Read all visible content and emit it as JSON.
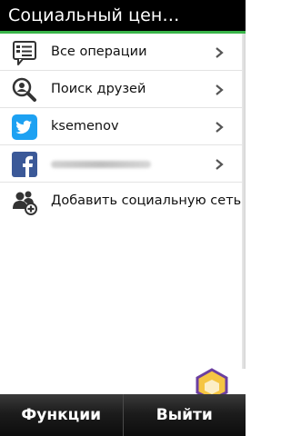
{
  "app": {
    "title": "Социальный цен…"
  },
  "list": [
    {
      "label": "Все операции",
      "icon": "activity-feed-icon"
    },
    {
      "label": "Поиск друзей",
      "icon": "search-icon"
    },
    {
      "label": "ksemenov",
      "icon": "twitter-icon"
    },
    {
      "label": "",
      "icon": "facebook-icon"
    },
    {
      "label": "Добавить социальную сеть",
      "icon": "add-social-network-icon"
    }
  ],
  "softkeys": {
    "left": "Функции",
    "right": "Выйти"
  },
  "colors": {
    "accent": "#39b54a",
    "twitter": "#1da1f2",
    "facebook": "#3b5998"
  }
}
